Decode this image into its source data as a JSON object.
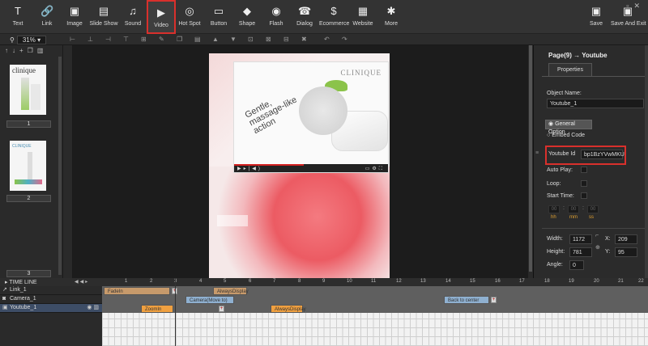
{
  "toolbar": {
    "items": [
      {
        "label": "Text",
        "icon": "T",
        "name": "text"
      },
      {
        "label": "Link",
        "icon": "🔗",
        "name": "link"
      },
      {
        "label": "Image",
        "icon": "▣",
        "name": "image"
      },
      {
        "label": "Slide Show",
        "icon": "▤",
        "name": "slide-show"
      },
      {
        "label": "Sound",
        "icon": "♫",
        "name": "sound"
      },
      {
        "label": "Video",
        "icon": "▶",
        "name": "video"
      },
      {
        "label": "Hot Spot",
        "icon": "◎",
        "name": "hot-spot"
      },
      {
        "label": "Button",
        "icon": "▭",
        "name": "button"
      },
      {
        "label": "Shape",
        "icon": "◆",
        "name": "shape"
      },
      {
        "label": "Flash",
        "icon": "◉",
        "name": "flash"
      },
      {
        "label": "Dialog",
        "icon": "☎",
        "name": "dialog"
      },
      {
        "label": "Ecommerce",
        "icon": "$",
        "name": "ecommerce"
      },
      {
        "label": "Website",
        "icon": "▦",
        "name": "website"
      },
      {
        "label": "More",
        "icon": "✱",
        "name": "more"
      }
    ],
    "save_label": "Save",
    "save_exit_label": "Save And Exit"
  },
  "zoom": {
    "label": "31%"
  },
  "pages": {
    "thumb1_brand": "clinique",
    "thumb2_brand": "CLINIQUE",
    "page_nums": [
      "1",
      "2",
      "3"
    ]
  },
  "canvas": {
    "video_brand": "CLINIQUE",
    "video_text": "Gentle, massage-like action"
  },
  "properties": {
    "breadcrumb": "Page(9) → Youtube",
    "tab": "Properties",
    "object_name_label": "Object Name:",
    "object_name_value": "Youtube_1",
    "general_option": "General Option",
    "embed_code": "Embed Code",
    "youtube_id_label": "Youtube Id",
    "youtube_id_value": "bp1BzYVwMKU",
    "auto_play_label": "Auto Play:",
    "loop_label": "Loop:",
    "start_time_label": "Start Time:",
    "time_hh": "00",
    "time_mm": "00",
    "time_ss": "00",
    "unit_hh": "hh",
    "unit_mm": "mm",
    "unit_ss": "ss",
    "width_label": "Width:",
    "width_value": "1172",
    "height_label": "Height:",
    "height_value": "781",
    "x_label": "X:",
    "x_value": "209",
    "y_label": "Y:",
    "y_value": "95",
    "angle_label": "Angle:",
    "angle_value": "0"
  },
  "timeline": {
    "title": "TIME LINE",
    "ticks": [
      "1",
      "2",
      "3",
      "4",
      "5",
      "6",
      "7",
      "8",
      "9",
      "10",
      "11",
      "12",
      "13",
      "14",
      "15",
      "16",
      "17",
      "18",
      "19",
      "20",
      "21",
      "22"
    ],
    "rows": [
      "Link_1",
      "Camera_1",
      "Youtube_1"
    ],
    "clips": {
      "fade_in": "FadeIn",
      "always_display_1": "AlwaysDisplay",
      "camera_move": "Camera(Move to)",
      "back_to_center": "Back to center",
      "zoom_in": "ZoomIn",
      "always_display_2": "AlwaysDisplay"
    }
  }
}
